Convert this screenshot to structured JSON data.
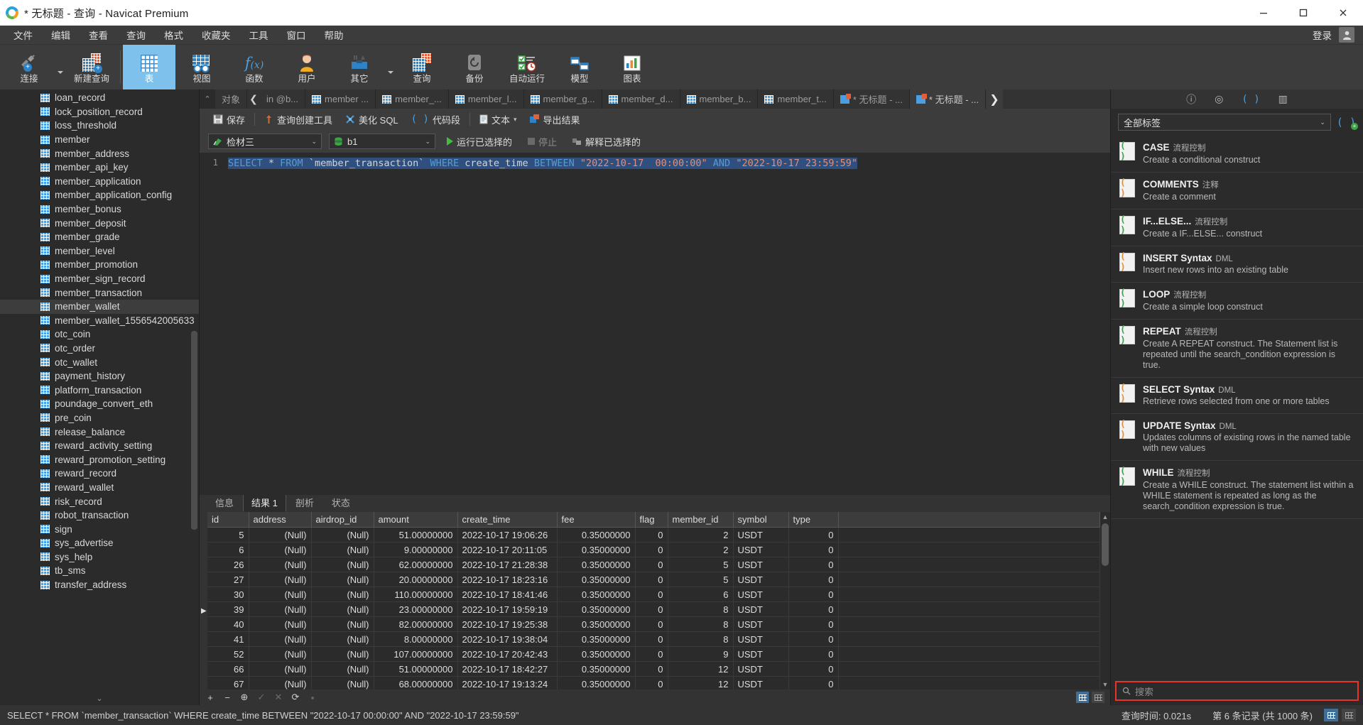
{
  "window": {
    "title": "* 无标题 - 查询 - Navicat Premium",
    "minimize": "—",
    "maximize": "▢",
    "close": "✕"
  },
  "menubar": {
    "items": [
      "文件",
      "编辑",
      "查看",
      "查询",
      "格式",
      "收藏夹",
      "工具",
      "窗口",
      "帮助"
    ],
    "login_label": "登录"
  },
  "ribbon": {
    "items": [
      {
        "label": "连接",
        "icon": "connection-icon",
        "has_caret": true,
        "active": false
      },
      {
        "label": "新建查询",
        "icon": "new-query-icon",
        "has_caret": false,
        "active": false
      },
      {
        "label": "表",
        "icon": "table-icon",
        "has_caret": false,
        "active": true
      },
      {
        "label": "视图",
        "icon": "view-icon",
        "has_caret": false,
        "active": false
      },
      {
        "label": "函数",
        "icon": "function-icon",
        "has_caret": false,
        "active": false
      },
      {
        "label": "用户",
        "icon": "user-icon",
        "has_caret": false,
        "active": false
      },
      {
        "label": "其它",
        "icon": "others-icon",
        "has_caret": true,
        "active": false
      },
      {
        "label": "查询",
        "icon": "query-icon",
        "has_caret": false,
        "active": false
      },
      {
        "label": "备份",
        "icon": "backup-icon",
        "has_caret": false,
        "active": false
      },
      {
        "label": "自动运行",
        "icon": "automation-icon",
        "has_caret": false,
        "active": false
      },
      {
        "label": "模型",
        "icon": "model-icon",
        "has_caret": false,
        "active": false
      },
      {
        "label": "图表",
        "icon": "chart-icon",
        "has_caret": false,
        "active": false
      }
    ]
  },
  "sidebar": {
    "tables": [
      {
        "name": "loan_record",
        "selected": false
      },
      {
        "name": "lock_position_record",
        "selected": false
      },
      {
        "name": "loss_threshold",
        "selected": false
      },
      {
        "name": "member",
        "selected": false
      },
      {
        "name": "member_address",
        "selected": false
      },
      {
        "name": "member_api_key",
        "selected": false
      },
      {
        "name": "member_application",
        "selected": false
      },
      {
        "name": "member_application_config",
        "selected": false
      },
      {
        "name": "member_bonus",
        "selected": false
      },
      {
        "name": "member_deposit",
        "selected": false
      },
      {
        "name": "member_grade",
        "selected": false
      },
      {
        "name": "member_level",
        "selected": false
      },
      {
        "name": "member_promotion",
        "selected": false
      },
      {
        "name": "member_sign_record",
        "selected": false
      },
      {
        "name": "member_transaction",
        "selected": false
      },
      {
        "name": "member_wallet",
        "selected": true
      },
      {
        "name": "member_wallet_1556542005633",
        "selected": false
      },
      {
        "name": "otc_coin",
        "selected": false
      },
      {
        "name": "otc_order",
        "selected": false
      },
      {
        "name": "otc_wallet",
        "selected": false
      },
      {
        "name": "payment_history",
        "selected": false
      },
      {
        "name": "platform_transaction",
        "selected": false
      },
      {
        "name": "poundage_convert_eth",
        "selected": false
      },
      {
        "name": "pre_coin",
        "selected": false
      },
      {
        "name": "release_balance",
        "selected": false
      },
      {
        "name": "reward_activity_setting",
        "selected": false
      },
      {
        "name": "reward_promotion_setting",
        "selected": false
      },
      {
        "name": "reward_record",
        "selected": false
      },
      {
        "name": "reward_wallet",
        "selected": false
      },
      {
        "name": "risk_record",
        "selected": false
      },
      {
        "name": "robot_transaction",
        "selected": false
      },
      {
        "name": "sign",
        "selected": false
      },
      {
        "name": "sys_advertise",
        "selected": false
      },
      {
        "name": "sys_help",
        "selected": false
      },
      {
        "name": "tb_sms",
        "selected": false
      },
      {
        "name": "transfer_address",
        "selected": false
      }
    ],
    "collapse_caret": "⌄"
  },
  "tabstrip": {
    "scroll_up": "⌃",
    "prev_arrow": "❮",
    "next_arrow": "❯",
    "tabs": [
      {
        "label": "对象",
        "icon": "none",
        "active": false
      },
      {
        "label": "in @b...",
        "icon": "none",
        "active": false
      },
      {
        "label": "member ...",
        "icon": "table-icon",
        "active": false
      },
      {
        "label": "member_...",
        "icon": "table-icon",
        "active": false
      },
      {
        "label": "member_l...",
        "icon": "table-icon",
        "active": false
      },
      {
        "label": "member_g...",
        "icon": "table-icon",
        "active": false
      },
      {
        "label": "member_d...",
        "icon": "table-icon",
        "active": false
      },
      {
        "label": "member_b...",
        "icon": "table-icon",
        "active": false
      },
      {
        "label": "member_t...",
        "icon": "table-icon",
        "active": false
      },
      {
        "label": "* 无标题 - ...",
        "icon": "query-icon",
        "active": false
      },
      {
        "label": "* 无标题 - ...",
        "icon": "query-icon",
        "active": true
      }
    ]
  },
  "query_toolbar": {
    "save": "保存",
    "query_builder": "查询创建工具",
    "beautify_sql": "美化 SQL",
    "snippets": "代码段",
    "text": "文本",
    "export_result": "导出结果"
  },
  "connection_row": {
    "connection": "检材三",
    "database": "b1",
    "run_selected": "运行已选择的",
    "stop": "停止",
    "explain_selected": "解释已选择的"
  },
  "editor": {
    "line_number": "1",
    "sql_parts": {
      "select": "SELECT",
      "star": " * ",
      "from": "FROM",
      "table": " `member_transaction` ",
      "where": "WHERE",
      "column": " create_time ",
      "between": "BETWEEN",
      "date_start": " \"2022-10-17  00:00:00\" ",
      "and": "AND",
      "date_end": " \"2022-10-17 23:59:59\""
    },
    "full_sql": "SELECT * FROM `member_transaction` WHERE create_time BETWEEN \"2022-10-17  00:00:00\" AND \"2022-10-17 23:59:59\""
  },
  "result_tabs": [
    {
      "label": "信息",
      "active": false
    },
    {
      "label": "结果 1",
      "active": true
    },
    {
      "label": "剖析",
      "active": false
    },
    {
      "label": "状态",
      "active": false
    }
  ],
  "result_grid": {
    "columns": [
      "id",
      "address",
      "airdrop_id",
      "amount",
      "create_time",
      "fee",
      "flag",
      "member_id",
      "symbol",
      "type"
    ],
    "rows": [
      {
        "id": "5",
        "address": "(Null)",
        "airdrop_id": "(Null)",
        "amount": "51.00000000",
        "create_time": "2022-10-17 19:06:26",
        "fee": "0.35000000",
        "flag": "0",
        "member_id": "2",
        "symbol": "USDT",
        "type": "0",
        "current": false
      },
      {
        "id": "6",
        "address": "(Null)",
        "airdrop_id": "(Null)",
        "amount": "9.00000000",
        "create_time": "2022-10-17 20:11:05",
        "fee": "0.35000000",
        "flag": "0",
        "member_id": "2",
        "symbol": "USDT",
        "type": "0",
        "current": false
      },
      {
        "id": "26",
        "address": "(Null)",
        "airdrop_id": "(Null)",
        "amount": "62.00000000",
        "create_time": "2022-10-17 21:28:38",
        "fee": "0.35000000",
        "flag": "0",
        "member_id": "5",
        "symbol": "USDT",
        "type": "0",
        "current": false
      },
      {
        "id": "27",
        "address": "(Null)",
        "airdrop_id": "(Null)",
        "amount": "20.00000000",
        "create_time": "2022-10-17 18:23:16",
        "fee": "0.35000000",
        "flag": "0",
        "member_id": "5",
        "symbol": "USDT",
        "type": "0",
        "current": false
      },
      {
        "id": "30",
        "address": "(Null)",
        "airdrop_id": "(Null)",
        "amount": "110.00000000",
        "create_time": "2022-10-17 18:41:46",
        "fee": "0.35000000",
        "flag": "0",
        "member_id": "6",
        "symbol": "USDT",
        "type": "0",
        "current": false
      },
      {
        "id": "39",
        "address": "(Null)",
        "airdrop_id": "(Null)",
        "amount": "23.00000000",
        "create_time": "2022-10-17 19:59:19",
        "fee": "0.35000000",
        "flag": "0",
        "member_id": "8",
        "symbol": "USDT",
        "type": "0",
        "current": true
      },
      {
        "id": "40",
        "address": "(Null)",
        "airdrop_id": "(Null)",
        "amount": "82.00000000",
        "create_time": "2022-10-17 19:25:38",
        "fee": "0.35000000",
        "flag": "0",
        "member_id": "8",
        "symbol": "USDT",
        "type": "0",
        "current": false
      },
      {
        "id": "41",
        "address": "(Null)",
        "airdrop_id": "(Null)",
        "amount": "8.00000000",
        "create_time": "2022-10-17 19:38:04",
        "fee": "0.35000000",
        "flag": "0",
        "member_id": "8",
        "symbol": "USDT",
        "type": "0",
        "current": false
      },
      {
        "id": "52",
        "address": "(Null)",
        "airdrop_id": "(Null)",
        "amount": "107.00000000",
        "create_time": "2022-10-17 20:42:43",
        "fee": "0.35000000",
        "flag": "0",
        "member_id": "9",
        "symbol": "USDT",
        "type": "0",
        "current": false
      },
      {
        "id": "66",
        "address": "(Null)",
        "airdrop_id": "(Null)",
        "amount": "51.00000000",
        "create_time": "2022-10-17 18:42:27",
        "fee": "0.35000000",
        "flag": "0",
        "member_id": "12",
        "symbol": "USDT",
        "type": "0",
        "current": false
      },
      {
        "id": "67",
        "address": "(Null)",
        "airdrop_id": "(Null)",
        "amount": "68.00000000",
        "create_time": "2022-10-17 19:13:24",
        "fee": "0.35000000",
        "flag": "0",
        "member_id": "12",
        "symbol": "USDT",
        "type": "0",
        "current": false
      }
    ]
  },
  "grid_toolbar": {
    "add": "+",
    "remove": "−",
    "duplicate": "⊕",
    "confirm": "✓",
    "cancel": "✕",
    "refresh": "⟳",
    "stop": "▪"
  },
  "right_panel": {
    "header_icons": [
      "info-icon",
      "target-icon",
      "code-icon",
      "table-icon"
    ],
    "filter_value": "全部标签",
    "add_snippet_icon": "add-snippet-icon",
    "snippets": [
      {
        "title": "CASE",
        "tag": "流程控制",
        "desc": "Create a conditional construct",
        "accent": "#3fa34a"
      },
      {
        "title": "COMMENTS",
        "tag": "注释",
        "desc": "Create a comment",
        "accent": "#e08f3c"
      },
      {
        "title": "IF...ELSE...",
        "tag": "流程控制",
        "desc": "Create a IF...ELSE... construct",
        "accent": "#3fa34a"
      },
      {
        "title": "INSERT Syntax",
        "tag": "DML",
        "desc": "Insert new rows into an existing table",
        "accent": "#e08f3c"
      },
      {
        "title": "LOOP",
        "tag": "流程控制",
        "desc": "Create a simple loop construct",
        "accent": "#3fa34a"
      },
      {
        "title": "REPEAT",
        "tag": "流程控制",
        "desc": "Create A REPEAT construct. The Statement list is repeated until the search_condition expression is true.",
        "accent": "#3fa34a"
      },
      {
        "title": "SELECT Syntax",
        "tag": "DML",
        "desc": "Retrieve rows selected from one or more tables",
        "accent": "#e08f3c"
      },
      {
        "title": "UPDATE Syntax",
        "tag": "DML",
        "desc": "Updates columns of existing rows in the named table with new values",
        "accent": "#e08f3c"
      },
      {
        "title": "WHILE",
        "tag": "流程控制",
        "desc": "Create a WHILE construct. The statement list within a WHILE statement is repeated as long as the search_condition expression is true.",
        "accent": "#3fa34a"
      }
    ],
    "search_placeholder": "搜索",
    "search_icon": "search-icon"
  },
  "status_bar": {
    "sql": "SELECT * FROM `member_transaction` WHERE create_time BETWEEN \"2022-10-17  00:00:00\" AND \"2022-10-17 23:59:59\"",
    "query_time": "查询时间: 0.021s",
    "row_info": "第 6 条记录 (共 1000 条)"
  },
  "colors": {
    "accent_blue": "#7ec1ec",
    "highlight_red": "#e8342a",
    "keyword_blue": "#569cd6",
    "string_orange": "#e08f7a",
    "selection_blue": "#2f4f7f"
  }
}
